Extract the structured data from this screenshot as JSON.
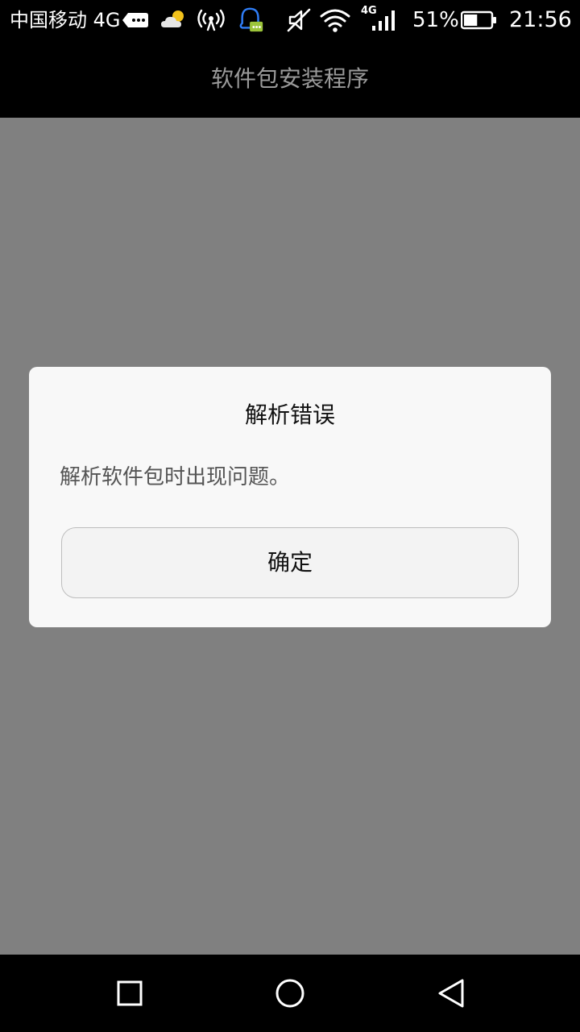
{
  "status_bar": {
    "carrier": "中国移动 4G",
    "network_label": "4G",
    "battery_percent": "51%",
    "battery_level": 0.51,
    "time": "21:56",
    "icons": [
      "message-icon",
      "weather-icon",
      "hotspot-icon",
      "qq-icon",
      "mute-icon",
      "wifi-icon",
      "signal-icon",
      "battery-icon"
    ]
  },
  "header": {
    "title": "软件包安装程序"
  },
  "dialog": {
    "title": "解析错误",
    "message": "解析软件包时出现问题。",
    "ok_label": "确定"
  },
  "nav": {
    "icons": [
      "recent-apps-icon",
      "home-icon",
      "back-icon"
    ]
  },
  "colors": {
    "overlay": "#808080",
    "dialog_bg": "#f8f8f8",
    "header_title": "#9a9a9a",
    "qq_accent": "#2f7df6"
  }
}
